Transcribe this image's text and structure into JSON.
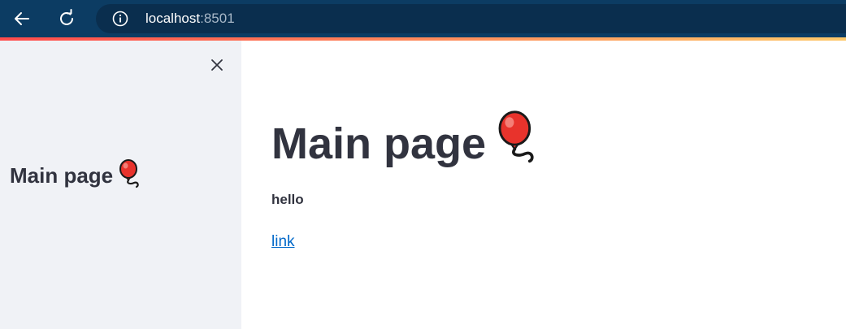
{
  "browser": {
    "url_host": "localhost",
    "url_port": ":8501",
    "back_icon": "back-arrow-icon",
    "reload_icon": "reload-icon",
    "info_icon": "info-icon",
    "toolbar_color": "#0c3c63",
    "accent_gradient": [
      "#ff4b4b",
      "#fdc86a"
    ]
  },
  "sidebar": {
    "title": "Main page",
    "title_icon": "balloon-icon",
    "close_icon": "close-icon",
    "background": "#f0f2f6"
  },
  "main": {
    "title": "Main page",
    "title_icon": "balloon-icon",
    "body_text": "hello",
    "link_text": "link",
    "link_color": "#0068c9",
    "text_color": "#31333f"
  }
}
